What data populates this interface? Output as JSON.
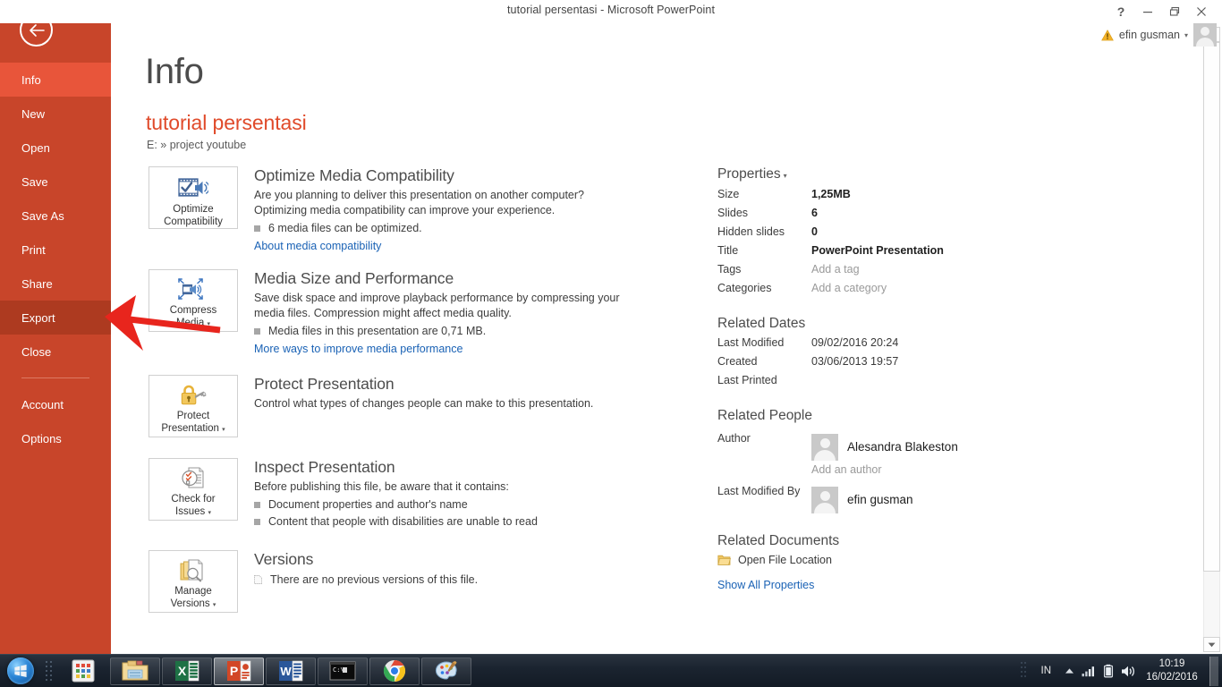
{
  "window": {
    "title": "tutorial persentasi - Microsoft PowerPoint",
    "help_label": "?",
    "minimize_label": "–",
    "restore_label": "❐",
    "close_label": "✕"
  },
  "account": {
    "name": "efin gusman",
    "caret": "▾",
    "warning_icon": "warning-triangle-icon",
    "avatar_icon": "user-avatar-icon"
  },
  "sidebar": {
    "back_icon": "back-arrow-icon",
    "items": [
      {
        "label": "Info",
        "state": "active"
      },
      {
        "label": "New",
        "state": "normal"
      },
      {
        "label": "Open",
        "state": "normal"
      },
      {
        "label": "Save",
        "state": "normal"
      },
      {
        "label": "Save As",
        "state": "normal"
      },
      {
        "label": "Print",
        "state": "normal"
      },
      {
        "label": "Share",
        "state": "normal"
      },
      {
        "label": "Export",
        "state": "hovered"
      },
      {
        "label": "Close",
        "state": "normal"
      },
      {
        "label": "Account",
        "state": "normal"
      },
      {
        "label": "Options",
        "state": "normal"
      }
    ],
    "colors": {
      "base": "#c8452a",
      "active": "#e8553a",
      "hovered": "#ad3a20"
    }
  },
  "main": {
    "page_title": "Info",
    "doc_title": "tutorial persentasi",
    "doc_path": "E: » project youtube",
    "cards": [
      {
        "tile_label_line1": "Optimize",
        "tile_label_line2": "Compatibility",
        "tile_caret": "",
        "icon": "film-check-speaker-icon",
        "heading": "Optimize Media Compatibility",
        "desc": "Are you planning to deliver this presentation on another computer? Optimizing media compatibility can improve your experience.",
        "bullets": [
          "6 media files can be optimized."
        ],
        "link": "About media compatibility"
      },
      {
        "tile_label_line1": "Compress",
        "tile_label_line2": "Media",
        "tile_caret": "▾",
        "icon": "compress-media-icon",
        "heading": "Media Size and Performance",
        "desc": "Save disk space and improve playback performance by compressing your media files. Compression might affect media quality.",
        "bullets": [
          "Media files in this presentation are 0,71 MB."
        ],
        "link": "More ways to improve media performance"
      },
      {
        "tile_label_line1": "Protect",
        "tile_label_line2": "Presentation",
        "tile_caret": "▾",
        "icon": "lock-key-icon",
        "heading": "Protect Presentation",
        "desc": "Control what types of changes people can make to this presentation.",
        "bullets": [],
        "link": ""
      },
      {
        "tile_label_line1": "Check for",
        "tile_label_line2": "Issues",
        "tile_caret": "▾",
        "icon": "document-inspect-icon",
        "heading": "Inspect Presentation",
        "desc": "Before publishing this file, be aware that it contains:",
        "bullets": [
          "Document properties and author's name",
          "Content that people with disabilities are unable to read"
        ],
        "link": ""
      },
      {
        "tile_label_line1": "Manage",
        "tile_label_line2": "Versions",
        "tile_caret": "▾",
        "icon": "versions-document-icon",
        "heading": "Versions",
        "desc": "",
        "bullets": [
          "There are no previous versions of this file."
        ],
        "link": ""
      }
    ]
  },
  "properties": {
    "heading": "Properties",
    "heading_caret": "▾",
    "rows": [
      {
        "key": "Size",
        "value": "1,25MB",
        "style": "bold"
      },
      {
        "key": "Slides",
        "value": "6",
        "style": "bold"
      },
      {
        "key": "Hidden slides",
        "value": "0",
        "style": "bold"
      },
      {
        "key": "Title",
        "value": "PowerPoint Presentation",
        "style": "bold"
      },
      {
        "key": "Tags",
        "value": "Add a tag",
        "style": "muted"
      },
      {
        "key": "Categories",
        "value": "Add a category",
        "style": "muted"
      }
    ],
    "related_dates": {
      "heading": "Related Dates",
      "rows": [
        {
          "key": "Last Modified",
          "value": "09/02/2016 20:24"
        },
        {
          "key": "Created",
          "value": "03/06/2013 19:57"
        },
        {
          "key": "Last Printed",
          "value": ""
        }
      ]
    },
    "related_people": {
      "heading": "Related People",
      "author_key": "Author",
      "author_name": "Alesandra Blakeston",
      "add_author": "Add an author",
      "modified_key": "Last Modified By",
      "modified_name": "efin gusman"
    },
    "related_documents": {
      "heading": "Related Documents",
      "open_location": "Open File Location",
      "folder_icon": "folder-icon",
      "show_all": "Show All Properties"
    }
  },
  "scrollbar": {
    "up_icon": "scroll-up-arrow-icon",
    "down_icon": "scroll-down-arrow-icon"
  },
  "annotation": {
    "type": "red-arrow",
    "color": "#e8251d",
    "points_to": "Export"
  },
  "taskbar": {
    "start_icon": "windows-start-orb-icon",
    "buttons": [
      {
        "name": "launcher-grid-icon",
        "state": "pinned"
      },
      {
        "name": "file-explorer-icon",
        "state": "pinned"
      },
      {
        "name": "excel-icon",
        "state": "pinned"
      },
      {
        "name": "powerpoint-icon",
        "state": "active"
      },
      {
        "name": "word-icon",
        "state": "pinned"
      },
      {
        "name": "command-prompt-icon",
        "state": "pinned"
      },
      {
        "name": "chrome-icon",
        "state": "pinned"
      },
      {
        "name": "paint-icon",
        "state": "pinned"
      }
    ],
    "tray": {
      "language": "IN",
      "icons": [
        "show-hidden-icons-arrow",
        "network-signal-icon",
        "battery-icon",
        "volume-icon"
      ],
      "time": "10:19",
      "date": "16/02/2016"
    }
  }
}
